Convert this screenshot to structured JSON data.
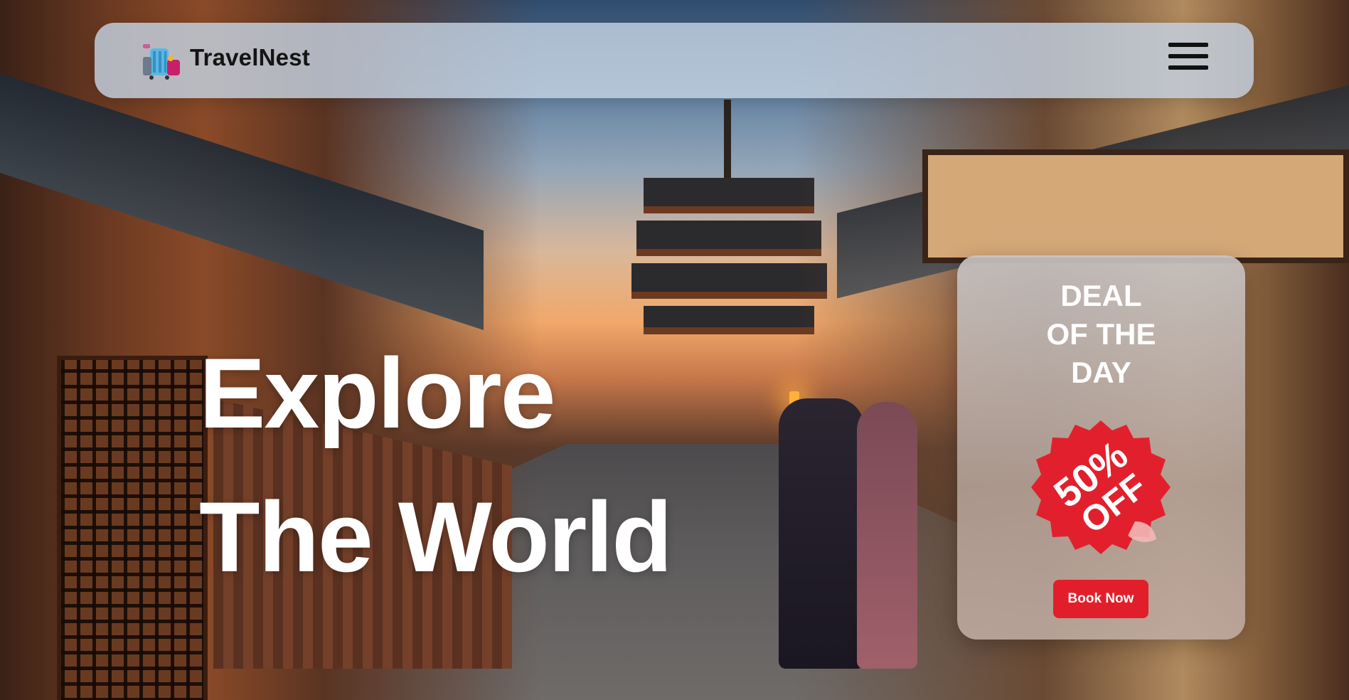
{
  "navbar": {
    "brand": "TravelNest",
    "logo_icon": "luggage-logo-icon",
    "menu_icon": "hamburger-menu-icon"
  },
  "hero": {
    "line1": "Explore",
    "line2": "The World"
  },
  "deal": {
    "title_line1": "DEAL",
    "title_line2": "OF THE",
    "title_line3": "DAY",
    "badge_line1": "50%",
    "badge_line2": "OFF",
    "badge_icon": "discount-badge-icon",
    "button_label": "Book Now"
  },
  "colors": {
    "accent": "#e31e2b",
    "navbar_bg": "#c4d2e2",
    "text_dark": "#141414",
    "text_light": "#ffffff"
  }
}
